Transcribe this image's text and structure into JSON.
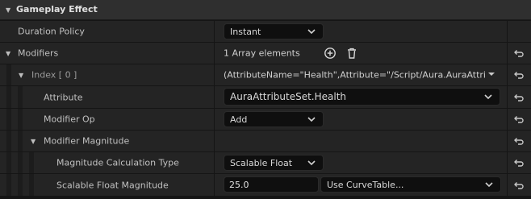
{
  "category": {
    "title": "Gameplay Effect"
  },
  "duration": {
    "label": "Duration Policy",
    "value": "Instant"
  },
  "modifiers": {
    "label": "Modifiers",
    "count_text": "1 Array elements"
  },
  "index0": {
    "label": "Index [ 0 ]",
    "summary": "(AttributeName=\"Health\",Attribute=\"/Script/Aura.AuraAttribut"
  },
  "attribute": {
    "label": "Attribute",
    "value": "AuraAttributeSet.Health"
  },
  "modifier_op": {
    "label": "Modifier Op",
    "value": "Add"
  },
  "modifier_magnitude": {
    "label": "Modifier Magnitude"
  },
  "calc_type": {
    "label": "Magnitude Calculation Type",
    "value": "Scalable Float"
  },
  "scalable": {
    "label": "Scalable Float Magnitude",
    "value": "25.0",
    "curve_table": "Use CurveTable..."
  }
}
